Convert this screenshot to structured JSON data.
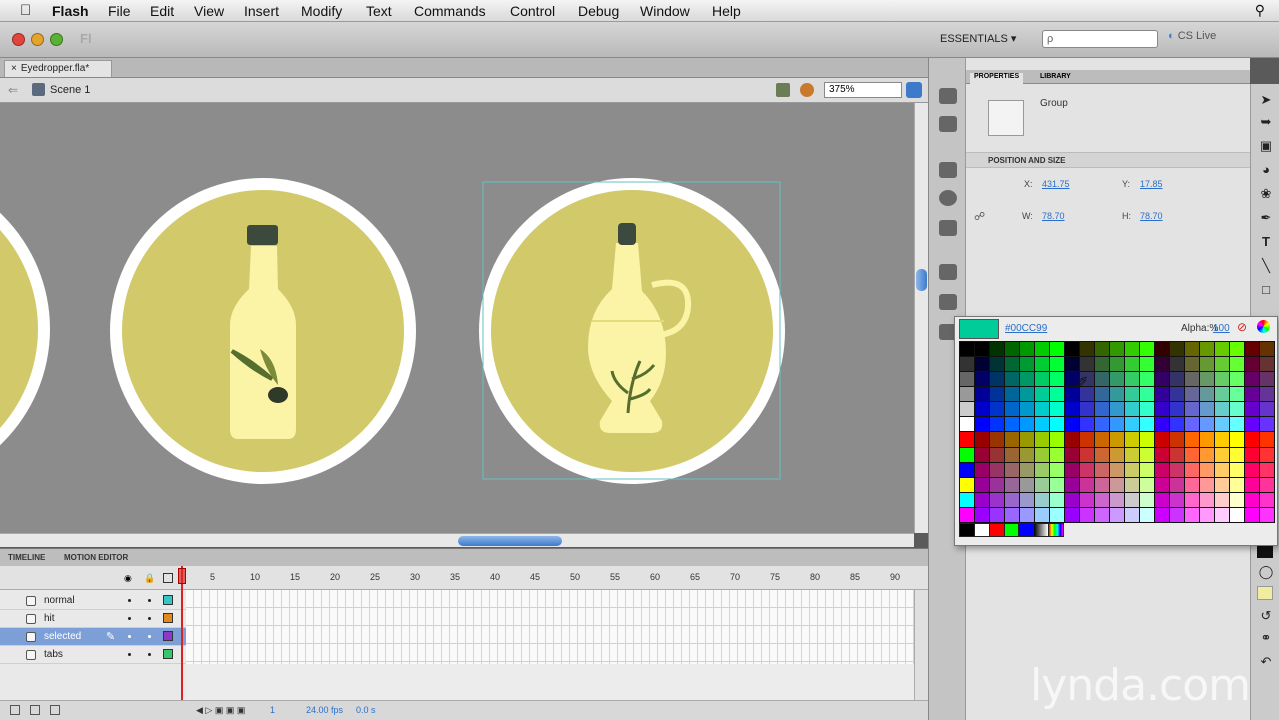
{
  "menubar": {
    "app": "Flash",
    "items": [
      "File",
      "Edit",
      "View",
      "Insert",
      "Modify",
      "Text",
      "Commands",
      "Control",
      "Debug",
      "Window",
      "Help"
    ]
  },
  "appbar": {
    "badge": "Fl",
    "workspace": "ESSENTIALS ▾",
    "search_placeholder": "ρ",
    "cslive": "CS Live"
  },
  "document": {
    "tab_name": "Eyedropper.fla*",
    "scene": "Scene 1",
    "zoom": "375%"
  },
  "stage": {
    "circle_fill": "#d1c96a",
    "circle_ring": "#ffffff",
    "bottle_fill": "#fbf3a6",
    "cap_color": "#3b4a3c",
    "leaf_color": "#556e2e",
    "selection_color": "#66c1c1"
  },
  "timeline": {
    "tab_timeline": "TIMELINE",
    "tab_motion": "MOTION EDITOR",
    "ruler": [
      "5",
      "10",
      "15",
      "20",
      "25",
      "30",
      "35",
      "40",
      "45",
      "50",
      "55",
      "60",
      "65",
      "70",
      "75",
      "80",
      "85",
      "90"
    ],
    "layers": [
      {
        "name": "normal",
        "color": "#36c6c6",
        "selected": false
      },
      {
        "name": "hit",
        "color": "#e08a20",
        "selected": false
      },
      {
        "name": "selected",
        "color": "#8a39c8",
        "selected": true
      },
      {
        "name": "tabs",
        "color": "#36c66b",
        "selected": false
      }
    ],
    "footer_frame": "1",
    "footer_fps": "24.00 fps",
    "footer_time": "0.0 s"
  },
  "properties": {
    "tab_properties": "PROPERTIES",
    "tab_library": "LIBRARY",
    "object_type": "Group",
    "section": "POSITION AND SIZE",
    "x_label": "X:",
    "x_value": "431.75",
    "y_label": "Y:",
    "y_value": "17.85",
    "w_label": "W:",
    "w_value": "78.70",
    "h_label": "H:",
    "h_value": "78.70"
  },
  "swatch": {
    "current_color": "#00CC99",
    "hex": "#00CC99",
    "alpha_label": "Alpha:%",
    "alpha_value": "100"
  },
  "watermark": "lynda.com"
}
